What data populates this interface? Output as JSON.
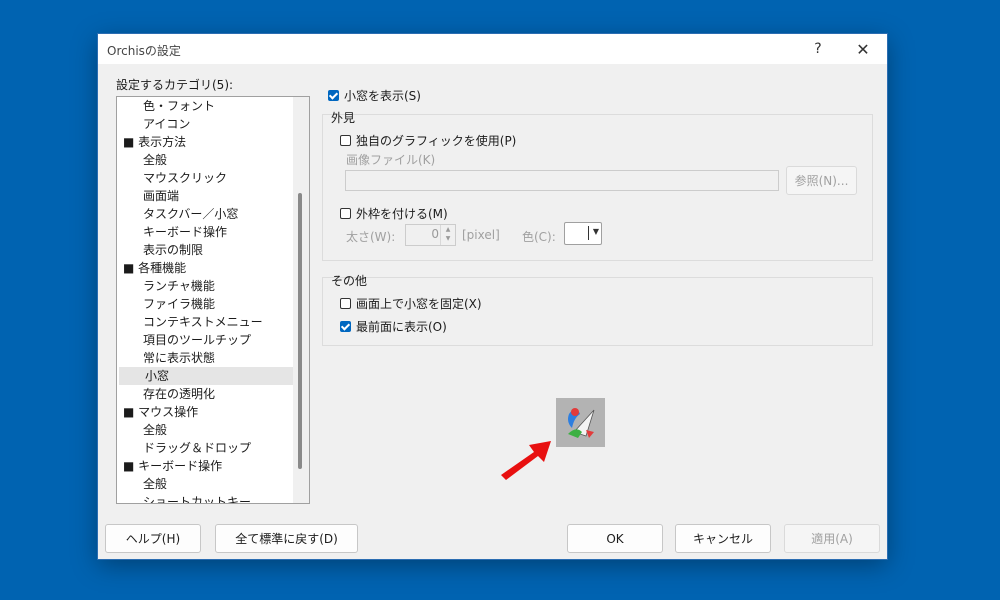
{
  "window": {
    "title": "Orchisの設定",
    "help_glyph": "?",
    "close_glyph": "✕"
  },
  "categories": {
    "label": "設定するカテゴリ(5):",
    "items": [
      {
        "label": "色・フォント",
        "type": "sub"
      },
      {
        "label": "アイコン",
        "type": "sub"
      },
      {
        "label": "■ 表示方法",
        "type": "group"
      },
      {
        "label": "全般",
        "type": "sub"
      },
      {
        "label": "マウスクリック",
        "type": "sub"
      },
      {
        "label": "画面端",
        "type": "sub"
      },
      {
        "label": "タスクバー／小窓",
        "type": "sub"
      },
      {
        "label": "キーボード操作",
        "type": "sub"
      },
      {
        "label": "表示の制限",
        "type": "sub"
      },
      {
        "label": "■ 各種機能",
        "type": "group"
      },
      {
        "label": "ランチャ機能",
        "type": "sub"
      },
      {
        "label": "ファイラ機能",
        "type": "sub"
      },
      {
        "label": "コンテキストメニュー",
        "type": "sub"
      },
      {
        "label": "項目のツールチップ",
        "type": "sub"
      },
      {
        "label": "常に表示状態",
        "type": "sub"
      },
      {
        "label": "小窓",
        "type": "sub",
        "selected": true
      },
      {
        "label": "存在の透明化",
        "type": "sub"
      },
      {
        "label": "■ マウス操作",
        "type": "group"
      },
      {
        "label": "全般",
        "type": "sub"
      },
      {
        "label": "ドラッグ＆ドロップ",
        "type": "sub"
      },
      {
        "label": "■ キーボード操作",
        "type": "group"
      },
      {
        "label": "全般",
        "type": "sub"
      },
      {
        "label": "ショートカットキー",
        "type": "sub"
      }
    ]
  },
  "panel": {
    "show_small_window": {
      "label": "小窓を表示(S)",
      "checked": true
    },
    "appearance": {
      "title": "外見",
      "custom_graphic": {
        "label": "独自のグラフィックを使用(P)",
        "checked": false
      },
      "image_file_label": "画像ファイル(K)",
      "image_file_value": "",
      "browse_label": "参照(N)...",
      "outer_frame": {
        "label": "外枠を付ける(M)",
        "checked": false
      },
      "thickness_label": "太さ(W):",
      "thickness_value": "0",
      "thickness_unit": "[pixel]",
      "color_label": "色(C):",
      "color_value": "#ffffff"
    },
    "other": {
      "title": "その他",
      "fix_on_screen": {
        "label": "画面上で小窓を固定(X)",
        "checked": false
      },
      "always_on_top": {
        "label": "最前面に表示(O)",
        "checked": true
      }
    }
  },
  "footer": {
    "help": "ヘルプ(H)",
    "reset_all": "全て標準に戻す(D)",
    "ok": "OK",
    "cancel": "キャンセル",
    "apply": "適用(A)"
  },
  "colors": {
    "desktop": "#0063b1",
    "accent": "#0067c0",
    "arrow": "#e81010"
  }
}
